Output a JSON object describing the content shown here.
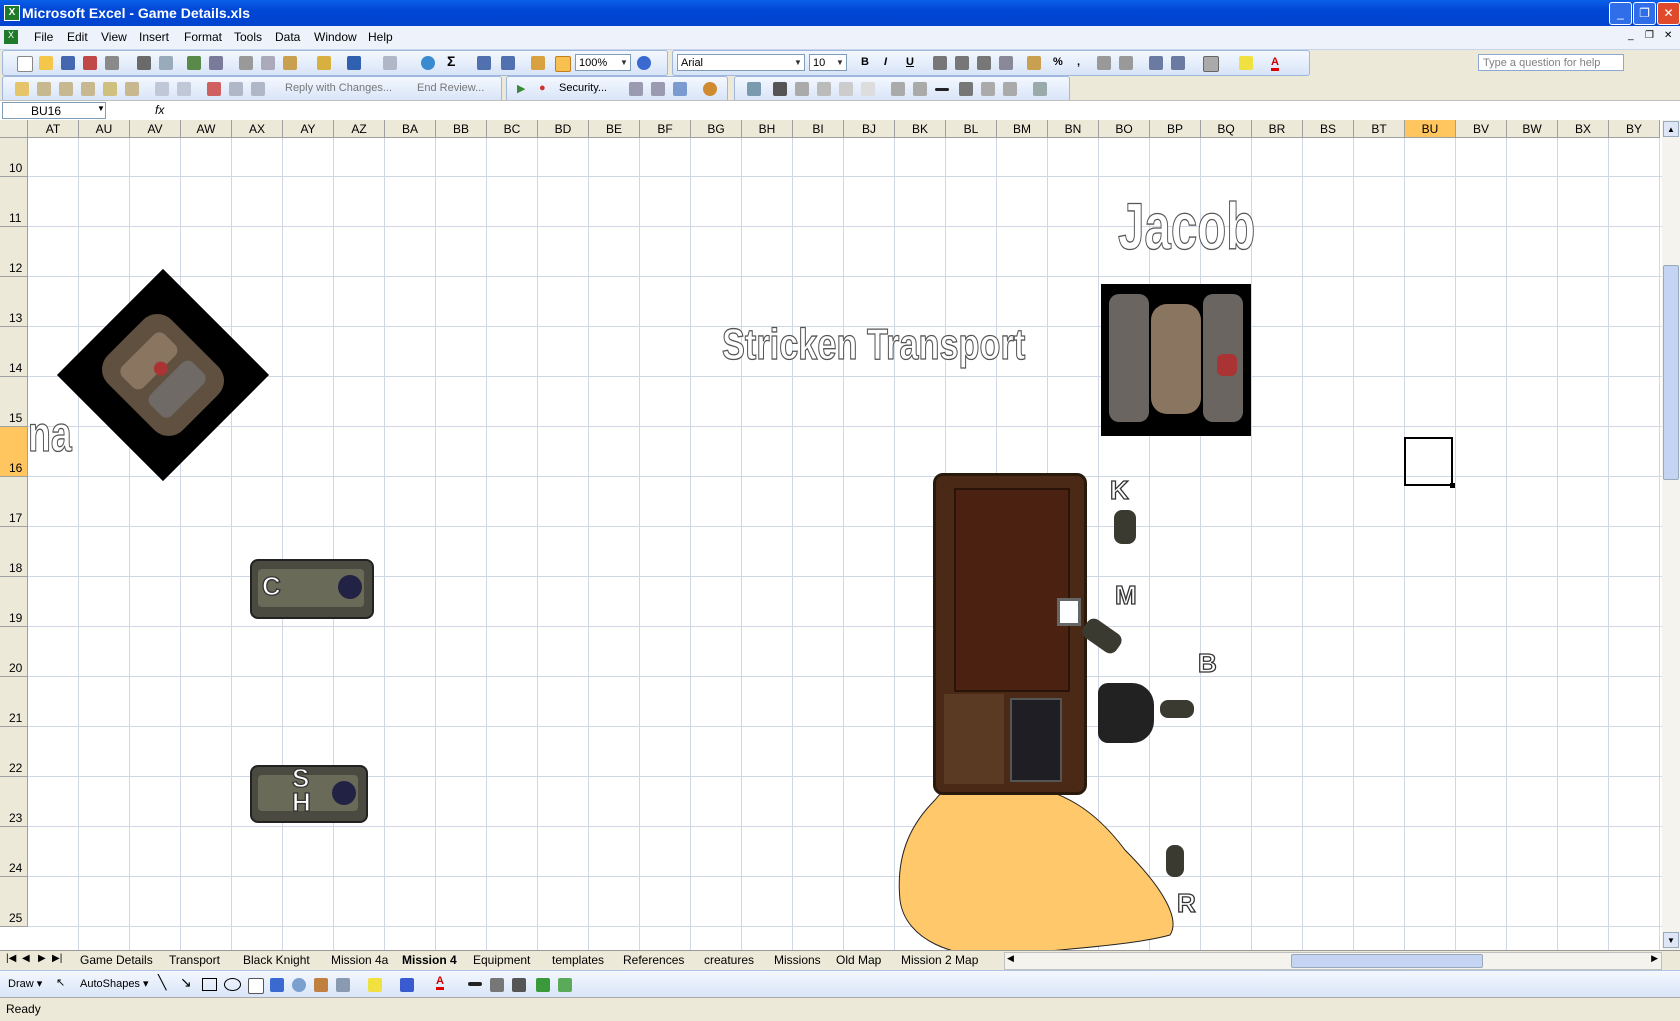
{
  "window": {
    "title": "Microsoft Excel - Game Details.xls",
    "app_icon": "excel-icon"
  },
  "menu": {
    "items": [
      "File",
      "Edit",
      "View",
      "Insert",
      "Format",
      "Tools",
      "Data",
      "Window",
      "Help"
    ],
    "help_placeholder": "Type a question for help"
  },
  "toolbar": {
    "zoom": "100%",
    "font": "Arial",
    "font_size": "10",
    "reply_label": "Reply with Changes...",
    "end_review_label": "End Review...",
    "security_label": "Security..."
  },
  "formula_bar": {
    "name_box": "BU16",
    "fx": "fx",
    "value": ""
  },
  "grid": {
    "columns": [
      "AT",
      "AU",
      "AV",
      "AW",
      "AX",
      "AY",
      "AZ",
      "BA",
      "BB",
      "BC",
      "BD",
      "BE",
      "BF",
      "BG",
      "BH",
      "BI",
      "BJ",
      "BK",
      "BL",
      "BM",
      "BN",
      "BO",
      "BP",
      "BQ",
      "BR",
      "BS",
      "BT",
      "BU",
      "BV",
      "BW",
      "BX",
      "BY"
    ],
    "rows": [
      "10",
      "11",
      "12",
      "13",
      "14",
      "15",
      "16",
      "17",
      "18",
      "19",
      "20",
      "21",
      "22",
      "23",
      "24",
      "25"
    ],
    "selected_column": "BU",
    "selected_row": "16"
  },
  "sheet_content": {
    "title_stricken": "Stricken Transport",
    "title_jacob": "Jacob",
    "partial_label": "na",
    "vehicle_c_label": "C",
    "vehicle_sh_label_1": "S",
    "vehicle_sh_label_2": "H",
    "unit_k": "K",
    "unit_m": "M",
    "unit_b": "B",
    "unit_r": "R"
  },
  "sheet_tabs": [
    "Game Details",
    "Transport",
    "Black Knight",
    "Mission 4a",
    "Mission 4",
    "Equipment",
    "templates",
    "References",
    "creatures",
    "Missions",
    "Old Map",
    "Mission 2 Map"
  ],
  "active_sheet": "Mission 4",
  "drawing": {
    "draw_label": "Draw",
    "autoshapes_label": "AutoShapes"
  },
  "status": {
    "text": "Ready"
  },
  "colors": {
    "selection_header": "#ffc660",
    "titlebar": "#0046d5",
    "sand": "#ffc86a"
  }
}
